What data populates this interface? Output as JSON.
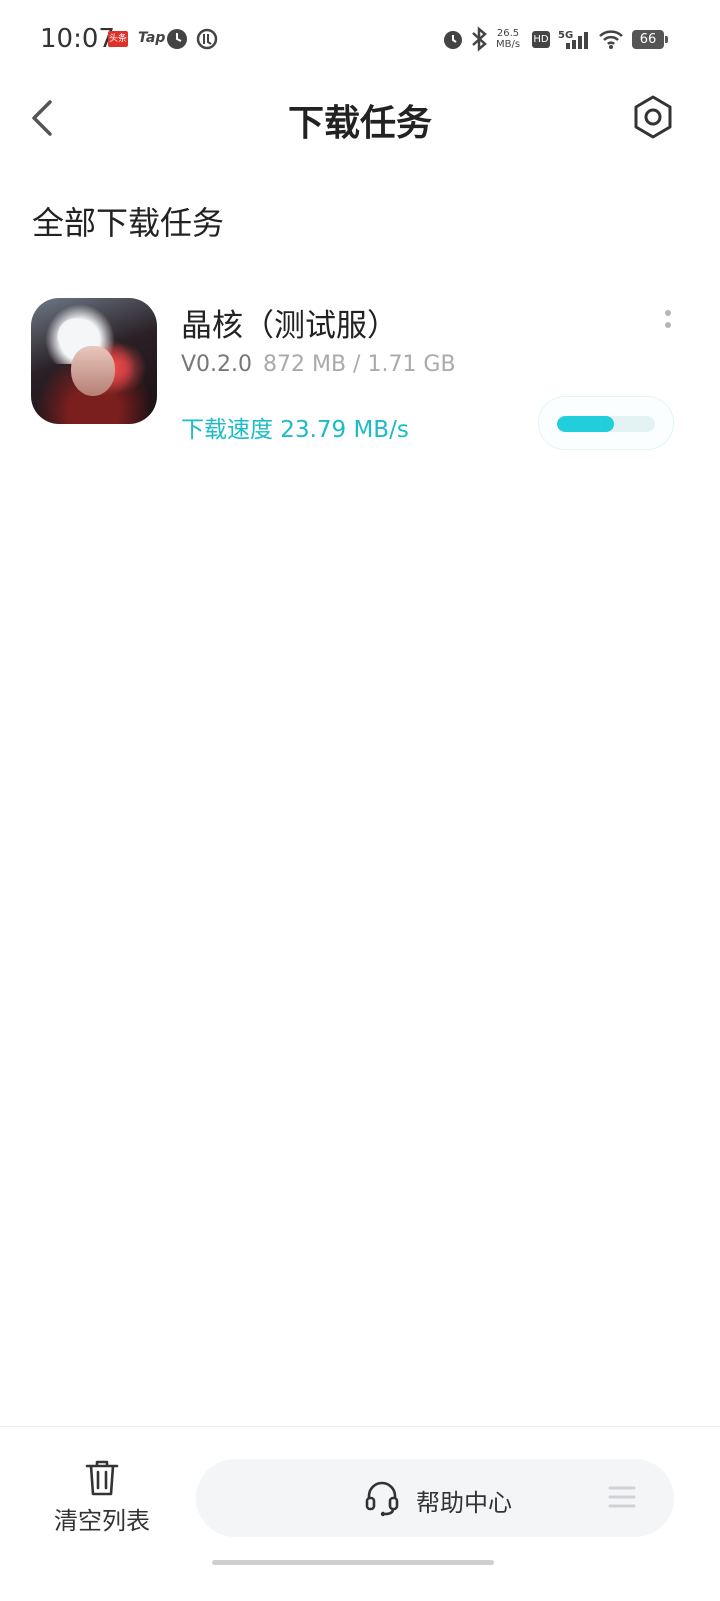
{
  "status_bar": {
    "time": "10:07",
    "toutiao_badge": "头条",
    "tap_logo": "Tap",
    "net_speed_value": "26.5",
    "net_speed_unit": "MB/s",
    "hd_badge": "HD",
    "network_type": "5G",
    "battery_level": "66",
    "icons": [
      "alarm-icon",
      "vpn-icon",
      "bluetooth-icon",
      "signal-icon",
      "wifi-icon",
      "battery-icon"
    ]
  },
  "header": {
    "title": "下载任务",
    "back_icon": "chevron-left-icon",
    "settings_icon": "hexagon-settings-icon"
  },
  "section": {
    "title": "全部下载任务"
  },
  "downloads": [
    {
      "name": "晶核（测试服）",
      "version": "V0.2.0",
      "size": "872 MB / 1.71 GB",
      "speed": "下载速度 23.79 MB/s",
      "progress": 0.58
    }
  ],
  "bottom_bar": {
    "clear_label": "清空列表",
    "help_label": "帮助中心",
    "accent_color": "#22cedb"
  }
}
